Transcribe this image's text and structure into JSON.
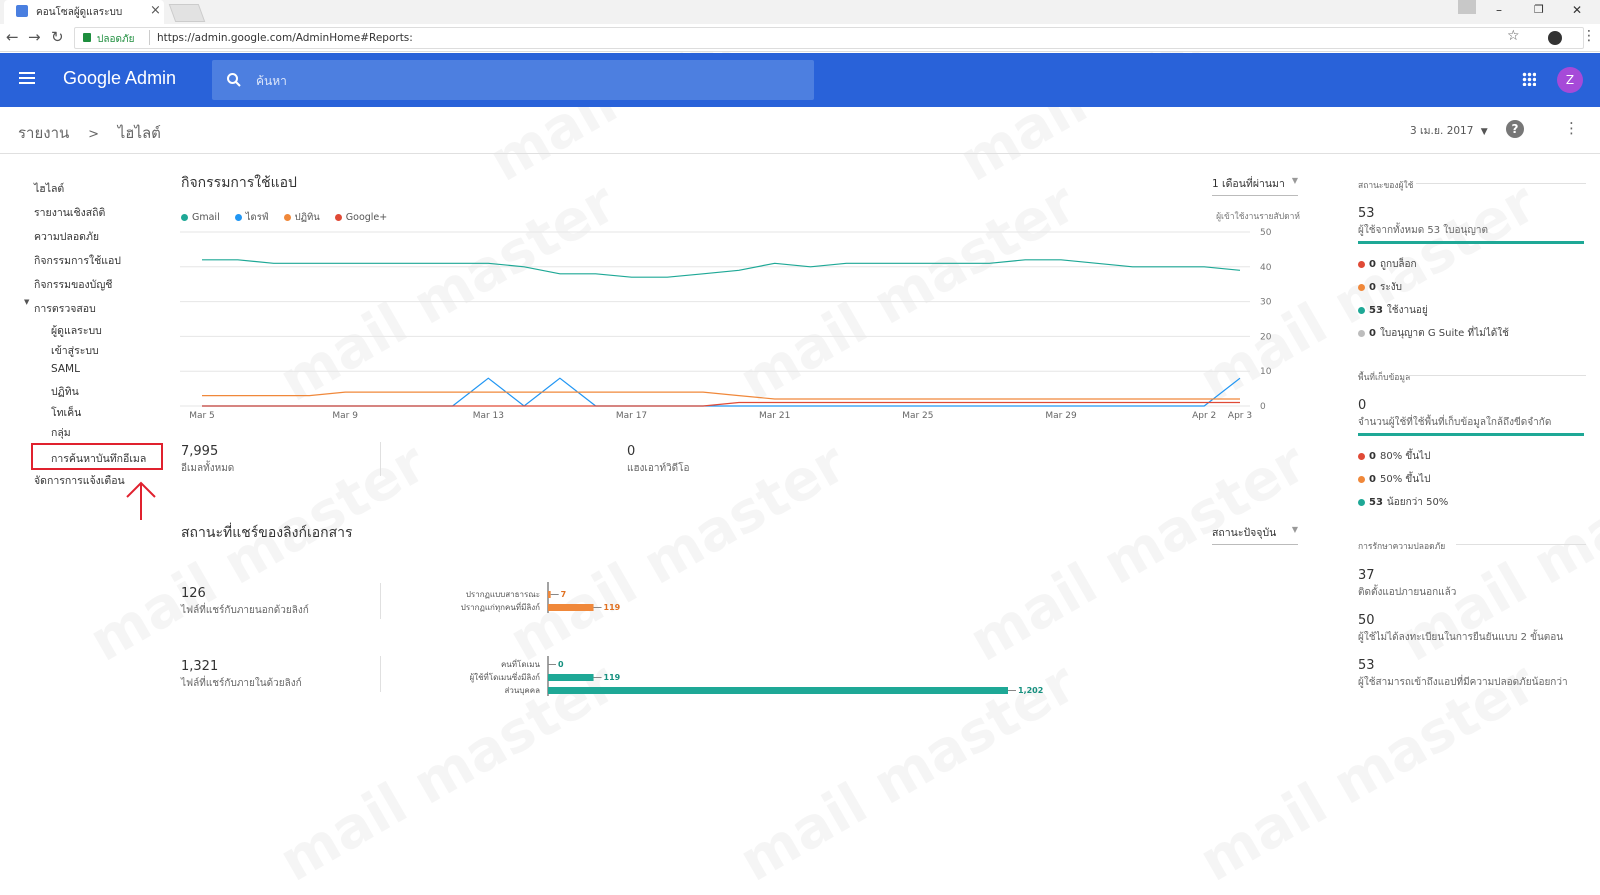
{
  "browser": {
    "tab_title": "คอนโซลผู้ดูแลระบบ",
    "tab_close": "×",
    "secure_label": "ปลอดภัย",
    "url": "https://admin.google.com/AdminHome#Reports:",
    "window_controls": {
      "minimize": "–",
      "restore": "❐",
      "close": "✕"
    }
  },
  "header": {
    "app_title": "Google Admin",
    "search_placeholder": "ค้นหา",
    "avatar_letter": "Z",
    "colors": {
      "bar": "#2962d9",
      "search": "#4d7fe0",
      "avatar": "#a64ad8"
    }
  },
  "breadcrumb": {
    "root": "รายงาน",
    "separator": ">",
    "current": "ไฮไลต์",
    "date": "3 เม.ย. 2017"
  },
  "sidebar": {
    "items": [
      {
        "label": "ไฮไลต์"
      },
      {
        "label": "รายงานเชิงสถิติ"
      },
      {
        "label": "ความปลอดภัย"
      },
      {
        "label": "กิจกรรมการใช้แอป"
      },
      {
        "label": "กิจกรรมของบัญชี"
      },
      {
        "label": "การตรวจสอบ"
      },
      {
        "label": "ผู้ดูแลระบบ"
      },
      {
        "label": "เข้าสู่ระบบ"
      },
      {
        "label": "SAML"
      },
      {
        "label": "ปฏิทิน"
      },
      {
        "label": "โทเค็น"
      },
      {
        "label": "กลุ่ม"
      },
      {
        "label": "การค้นหาบันทึกอีเมล"
      },
      {
        "label": "จัดการการแจ้งเตือน"
      }
    ]
  },
  "activity": {
    "title": "กิจกรรมการใช้แอป",
    "period": "1 เดือนที่ผ่านมา",
    "right_axis_label": "ผู้เข้าใช้งานรายสัปดาห์",
    "legend": [
      {
        "name": "Gmail",
        "color": "#1ea896"
      },
      {
        "name": "ไดรฟ์",
        "color": "#2196f3"
      },
      {
        "name": "ปฏิทิน",
        "color": "#f0883a"
      },
      {
        "name": "Google+",
        "color": "#e04a36"
      }
    ],
    "stat1_value": "7,995",
    "stat1_label": "อีเมลทั้งหมด",
    "stat2_value": "0",
    "stat2_label": "แฮงเอาท์วิดีโอ"
  },
  "chart_data": {
    "type": "line",
    "x": [
      "Mar 5",
      "Mar 6",
      "Mar 7",
      "Mar 8",
      "Mar 9",
      "Mar 10",
      "Mar 11",
      "Mar 12",
      "Mar 13",
      "Mar 14",
      "Mar 15",
      "Mar 16",
      "Mar 17",
      "Mar 18",
      "Mar 19",
      "Mar 20",
      "Mar 21",
      "Mar 22",
      "Mar 23",
      "Mar 24",
      "Mar 25",
      "Mar 26",
      "Mar 27",
      "Mar 28",
      "Mar 29",
      "Mar 30",
      "Mar 31",
      "Apr 1",
      "Apr 2",
      "Apr 3"
    ],
    "tick_labels": [
      "Mar 5",
      "Mar 9",
      "Mar 13",
      "Mar 17",
      "Mar 21",
      "Mar 25",
      "Mar 29",
      "Apr 2",
      "Apr 3"
    ],
    "tick_indices": [
      0,
      4,
      8,
      12,
      16,
      20,
      24,
      28,
      29
    ],
    "yticks": [
      "50",
      "40",
      "30",
      "20",
      "10",
      "0"
    ],
    "ylim": [
      0,
      50
    ],
    "grid": true,
    "series": [
      {
        "name": "Gmail",
        "color": "#1ea896",
        "values": [
          42,
          42,
          41,
          41,
          41,
          41,
          41,
          41,
          41,
          40,
          38,
          38,
          37,
          37,
          38,
          39,
          41,
          40,
          41,
          41,
          41,
          41,
          41,
          42,
          42,
          41,
          40,
          40,
          40,
          39
        ]
      },
      {
        "name": "ไดรฟ์",
        "color": "#2196f3",
        "values": [
          0,
          0,
          0,
          0,
          0,
          0,
          0,
          0,
          8,
          0,
          8,
          0,
          0,
          0,
          0,
          0,
          0,
          0,
          0,
          0,
          0,
          0,
          0,
          0,
          0,
          0,
          0,
          0,
          0,
          8
        ]
      },
      {
        "name": "ปฏิทิน",
        "color": "#f0883a",
        "values": [
          3,
          3,
          3,
          3,
          4,
          4,
          4,
          4,
          4,
          4,
          4,
          4,
          4,
          4,
          4,
          3,
          2,
          2,
          2,
          2,
          2,
          2,
          2,
          2,
          2,
          2,
          2,
          2,
          2,
          2
        ]
      },
      {
        "name": "Google+",
        "color": "#e04a36",
        "values": [
          0,
          0,
          0,
          0,
          0,
          0,
          0,
          0,
          0,
          0,
          0,
          0,
          0,
          0,
          0,
          1,
          1,
          1,
          1,
          1,
          1,
          1,
          1,
          1,
          1,
          1,
          1,
          1,
          1,
          1
        ]
      }
    ]
  },
  "sharing": {
    "title": "สถานะที่แชร์ของลิงก์เอกสาร",
    "status_dropdown": "สถานะปัจจุบัน",
    "external": {
      "value": "126",
      "label": "ไฟล์ที่แชร์กับภายนอกด้วยลิงก์",
      "bars": [
        {
          "label": "ปรากฏแบบสาธารณะ",
          "value": "7",
          "color": "#f0883a"
        },
        {
          "label": "ปรากฏแก่ทุกคนที่มีลิงก์",
          "value": "119",
          "color": "#f0883a"
        }
      ]
    },
    "internal": {
      "value": "1,321",
      "label": "ไฟล์ที่แชร์กับภายในด้วยลิงก์",
      "bars": [
        {
          "label": "คนที่โดเมน",
          "value": "0",
          "color": "#1ea896"
        },
        {
          "label": "ผู้ใช้ที่โดเมนซึ่งมีลิงก์",
          "value": "119",
          "color": "#1ea896"
        },
        {
          "label": "ส่วนบุคคล",
          "value": "1,202",
          "color": "#1ea896"
        }
      ]
    }
  },
  "right_panel": {
    "user_status": {
      "heading": "สถานะของผู้ใช้",
      "value": "53",
      "caption": "ผู้ใช้จากทั้งหมด 53 ใบอนุญาต",
      "rows": [
        {
          "count": "0",
          "label": "ถูกบล็อก",
          "color": "#e04a36"
        },
        {
          "count": "0",
          "label": "ระงับ",
          "color": "#f0883a"
        },
        {
          "count": "53",
          "label": "ใช้งานอยู่",
          "color": "#1ea896"
        },
        {
          "count": "0",
          "label": "ใบอนุญาต G Suite ที่ไม่ได้ใช้",
          "color": "#bdbdbd"
        }
      ]
    },
    "storage": {
      "heading": "พื้นที่เก็บข้อมูล",
      "value": "0",
      "caption": "จำนวนผู้ใช้ที่ใช้พื้นที่เก็บข้อมูลใกล้ถึงขีดจำกัด",
      "rows": [
        {
          "count": "0",
          "label": "80% ขึ้นไป",
          "color": "#e04a36"
        },
        {
          "count": "0",
          "label": "50% ขึ้นไป",
          "color": "#f0883a"
        },
        {
          "count": "53",
          "label": "น้อยกว่า 50%",
          "color": "#1ea896"
        }
      ]
    },
    "security": {
      "heading": "การรักษาความปลอดภัย",
      "items": [
        {
          "value": "37",
          "caption": "ติดตั้งแอปภายนอกแล้ว"
        },
        {
          "value": "50",
          "caption": "ผู้ใช้ไม่ได้ลงทะเบียนในการยืนยันแบบ 2 ขั้นตอน"
        },
        {
          "value": "53",
          "caption": "ผู้ใช้สามารถเข้าถึงแอปที่มีความปลอดภัยน้อยกว่า"
        }
      ]
    }
  },
  "watermark": "mail master"
}
